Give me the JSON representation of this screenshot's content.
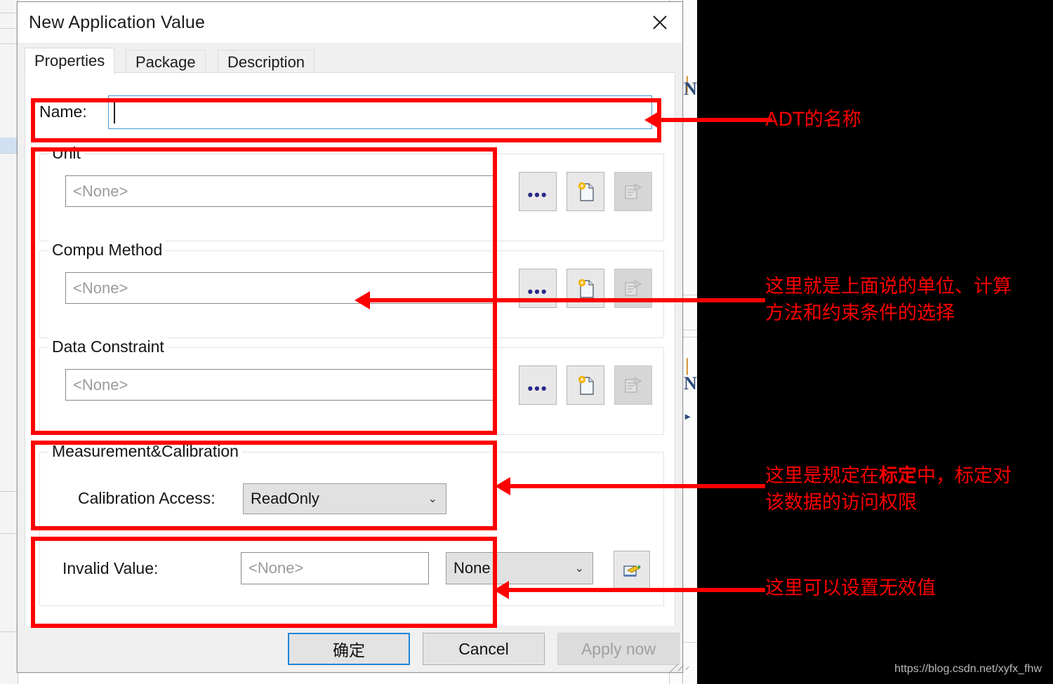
{
  "window": {
    "title": "New Application Value",
    "close_icon": "close-icon"
  },
  "tabs": [
    {
      "label": "Properties",
      "active": true
    },
    {
      "label": "Package",
      "active": false
    },
    {
      "label": "Description",
      "active": false
    }
  ],
  "form": {
    "name": {
      "label": "Name:",
      "value": "",
      "placeholder": ""
    },
    "unit": {
      "group_label": "Unit",
      "value": "<None>",
      "buttons": [
        "browse-ellipsis",
        "new-document",
        "edit-properties"
      ]
    },
    "compu_method": {
      "group_label": "Compu Method",
      "value": "<None>",
      "buttons": [
        "browse-ellipsis",
        "new-document",
        "edit-properties"
      ]
    },
    "data_constraint": {
      "group_label": "Data Constraint",
      "value": "<None>",
      "buttons": [
        "browse-ellipsis",
        "new-document",
        "edit-properties"
      ]
    },
    "measurement_calibration": {
      "group_label": "Measurement&Calibration",
      "calibration_access": {
        "label": "Calibration Access:",
        "value": "ReadOnly"
      }
    },
    "invalid_value": {
      "label": "Invalid Value:",
      "text_value": "<None>",
      "select_value": "None",
      "button_icon": "set-value-icon"
    }
  },
  "footer": {
    "ok_label": "确定",
    "cancel_label": "Cancel",
    "apply_label": "Apply now"
  },
  "annotations": [
    {
      "text": "ADT的名称"
    },
    {
      "text": "这里就是上面说的单位、计算\n方法和约束条件的选择"
    },
    {
      "text_pre": "这里是规定在",
      "text_bold": "标定",
      "text_post": "中，标定对\n该数据的访问权限"
    },
    {
      "text": "这里可以设置无效值"
    }
  ],
  "watermark": "https://blog.csdn.net/xyfx_fhw",
  "colors": {
    "annotation_red": "#fe0000",
    "accent_blue": "#1e84d8",
    "field_border": "#8a8a8a",
    "placeholder": "#9b9b9b",
    "background": "#000000"
  }
}
